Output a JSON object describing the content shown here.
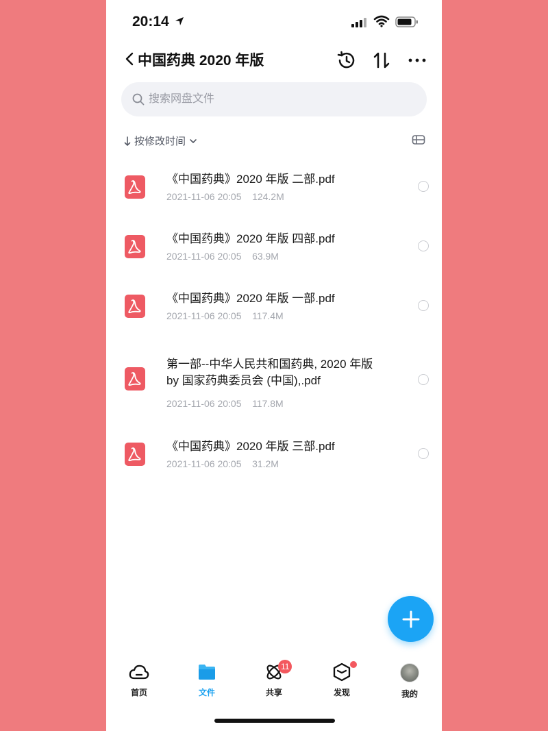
{
  "status_bar": {
    "time": "20:14"
  },
  "header": {
    "title": "中国药典 2020 年版"
  },
  "search": {
    "placeholder": "搜索网盘文件"
  },
  "sort": {
    "label": "按修改时间"
  },
  "files": [
    {
      "name": "《中国药典》2020 年版 二部.pdf",
      "date": "2021-11-06 20:05",
      "size": "124.2M"
    },
    {
      "name": "《中国药典》2020 年版 四部.pdf",
      "date": "2021-11-06 20:05",
      "size": "63.9M"
    },
    {
      "name": "《中国药典》2020 年版 一部.pdf",
      "date": "2021-11-06 20:05",
      "size": "117.4M"
    },
    {
      "name": "第一部--中华人民共和国药典, 2020 年版 by 国家药典委员会 (中国),.pdf",
      "date": "2021-11-06 20:05",
      "size": "117.8M"
    },
    {
      "name": "《中国药典》2020 年版 三部.pdf",
      "date": "2021-11-06 20:05",
      "size": "31.2M"
    }
  ],
  "tabs": [
    {
      "label": "首页",
      "icon": "cloud-icon"
    },
    {
      "label": "文件",
      "icon": "folder-icon",
      "active": true
    },
    {
      "label": "共享",
      "icon": "share-atom-icon",
      "badge": "11"
    },
    {
      "label": "发现",
      "icon": "discover-cube-icon",
      "dot": true
    },
    {
      "label": "我的",
      "icon": "avatar"
    }
  ],
  "colors": {
    "background": "#ef7b7e",
    "accent": "#1ba4f5",
    "pdf_icon": "#ee5a63",
    "badge": "#f3585e"
  }
}
